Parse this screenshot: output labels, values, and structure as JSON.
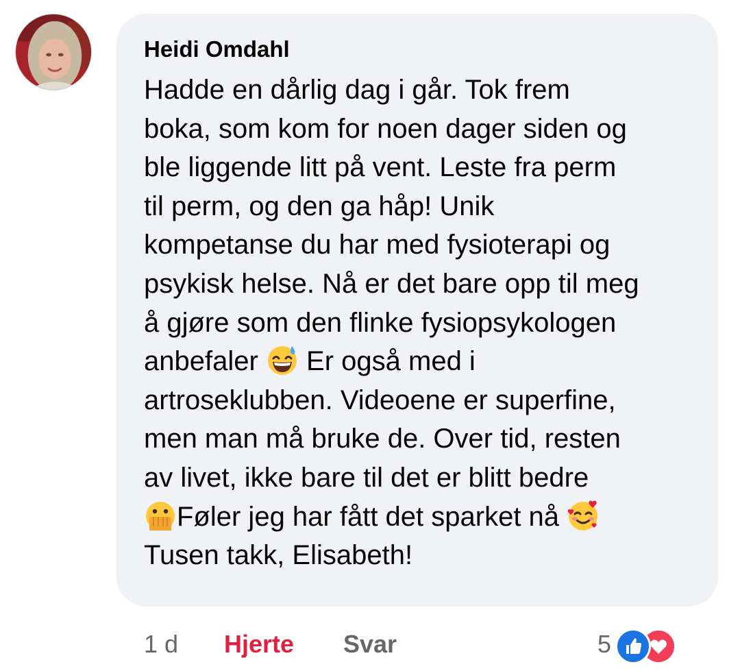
{
  "comment": {
    "author": "Heidi Omdahl",
    "lines": [
      "Hadde en dårlig dag i går. Tok frem",
      "boka, som kom for noen dager siden og",
      "ble liggende litt på vent. Leste fra perm",
      "til perm, og den ga håp! Unik",
      "kompetanse du har med fysioterapi og",
      "psykisk helse. Nå er det bare opp til meg",
      "å gjøre som den flinke fysiopsykologen"
    ],
    "line8_before": "anbefaler ",
    "line8_after": " Er også med i",
    "line9": "artroseklubben. Videoene er superfine,",
    "line10": "men man må bruke de. Over tid, resten",
    "line11": "av livet, ikke bare til det er blitt bedre",
    "line12_after": "Føler jeg har fått det sparket nå ",
    "line13": "Tusen takk, Elisabeth!"
  },
  "footer": {
    "timestamp": "1 d",
    "heart_label": "Hjerte",
    "reply_label": "Svar",
    "reaction_count": "5"
  },
  "icons": {
    "emoji_1": "grinning-face-with-sweat-emoji",
    "emoji_2": "face-with-open-eyes-and-hand-over-mouth-emoji",
    "emoji_3": "smiling-face-with-hearts-emoji",
    "reaction_like": "like-reaction-icon",
    "reaction_love": "love-reaction-icon"
  },
  "colors": {
    "bubble_bg": "#f0f2f5",
    "heart_active": "#e41e3f",
    "secondary_text": "#65676b",
    "like_blue": "#1b74e4",
    "love_red": "#f33e58"
  }
}
